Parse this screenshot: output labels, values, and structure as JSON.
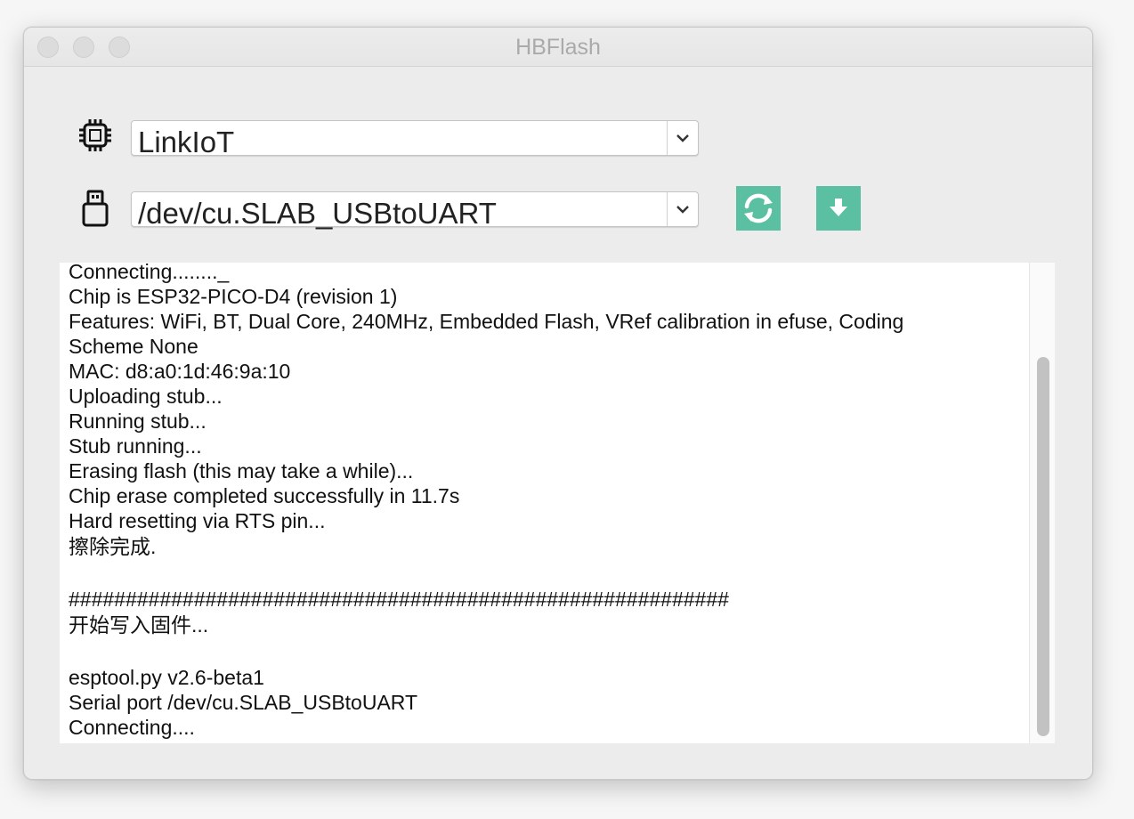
{
  "window": {
    "title": "HBFlash"
  },
  "device": {
    "icon": "chip-icon",
    "selected": "LinkIoT"
  },
  "port": {
    "icon": "usb-icon",
    "selected": "/dev/cu.SLAB_USBtoUART"
  },
  "toolbar": {
    "refresh_icon": "refresh-icon",
    "download_icon": "download-icon",
    "accent_color": "#5bbfa2"
  },
  "log": {
    "lines": [
      "Connecting........_",
      "Chip is ESP32-PICO-D4 (revision 1)",
      "Features: WiFi, BT, Dual Core, 240MHz, Embedded Flash, VRef calibration in efuse, Coding",
      "Scheme None",
      "MAC: d8:a0:1d:46:9a:10",
      "Uploading stub...",
      "Running stub...",
      "Stub running...",
      "Erasing flash (this may take a while)...",
      "Chip erase completed successfully in 11.7s",
      "Hard resetting via RTS pin...",
      "擦除完成.",
      "",
      "##########################################################",
      "开始写入固件...",
      "",
      "esptool.py v2.6-beta1",
      "Serial port /dev/cu.SLAB_USBtoUART",
      "Connecting...."
    ]
  }
}
